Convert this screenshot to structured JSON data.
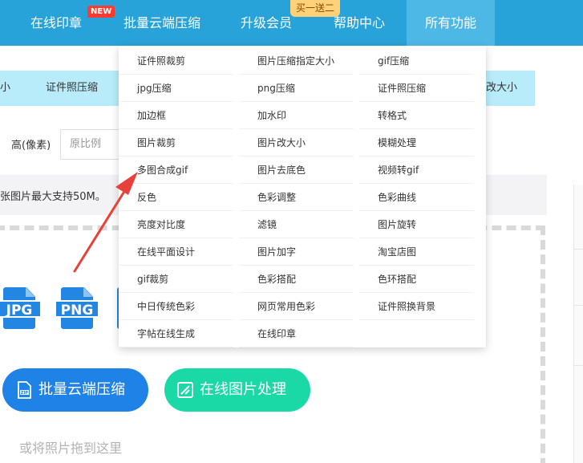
{
  "topnav": {
    "items": [
      {
        "label": "在线印章"
      },
      {
        "label": "批量云端压缩"
      },
      {
        "label": "升级会员"
      },
      {
        "label": "帮助中心"
      },
      {
        "label": "所有功能"
      }
    ],
    "new_badge": "NEW",
    "promo_badge": "买一送二"
  },
  "subbar": {
    "items": [
      {
        "label": "小"
      },
      {
        "label": "证件照压缩"
      },
      {
        "label": "改大小"
      }
    ]
  },
  "form": {
    "height_label": "高(像素)",
    "height_placeholder": "原比例"
  },
  "notice": "张图片最大支持50M。",
  "file_types": [
    "JPG",
    "PNG"
  ],
  "buttons": {
    "batch": "批量云端压缩",
    "online": "在线图片处理"
  },
  "drag_hint": "或将照片拖到这里",
  "dropdown": {
    "items": [
      "证件照裁剪",
      "图片压缩指定大小",
      "gif压缩",
      "jpg压缩",
      "png压缩",
      "证件照压缩",
      "加边框",
      "加水印",
      "转格式",
      "图片裁剪",
      "图片改大小",
      "模糊处理",
      "多图合成gif",
      "图片去底色",
      "视频转gif",
      "反色",
      "色彩调整",
      "色彩曲线",
      "亮度对比度",
      "滤镜",
      "图片旋转",
      "在线平面设计",
      "图片加字",
      "淘宝店图",
      "gif裁剪",
      "色彩搭配",
      "色环搭配",
      "中日传统色彩",
      "网页常用色彩",
      "证件照换背景",
      "字帖在线生成",
      "在线印章"
    ]
  },
  "colors": {
    "nav": "#27a3d9",
    "nav_active": "#4db8e6",
    "subbar": "#b9ecfb",
    "btn_blue": "#1f82e6",
    "btn_green": "#1ad9a6",
    "arrow": "#e8413b"
  }
}
